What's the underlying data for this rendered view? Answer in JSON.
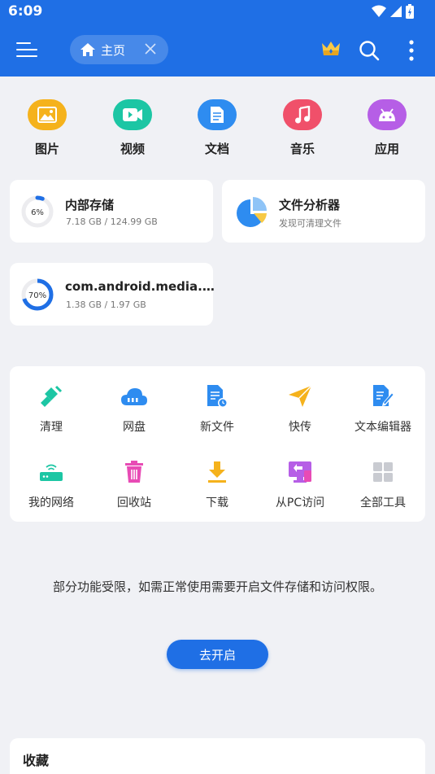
{
  "status_bar": {
    "time": "6:09"
  },
  "app_bar": {
    "tab_label": "主页",
    "icons": [
      "menu-icon",
      "home-icon",
      "close-icon",
      "crown-icon",
      "search-icon",
      "more-vert-icon"
    ]
  },
  "categories": [
    {
      "label": "图片",
      "icon": "image-icon",
      "color": "#f5b21c"
    },
    {
      "label": "视频",
      "icon": "video-icon",
      "color": "#1cc6a4"
    },
    {
      "label": "文档",
      "icon": "document-icon",
      "color": "#2e8cf0"
    },
    {
      "label": "音乐",
      "icon": "music-icon",
      "color": "#f0506a"
    },
    {
      "label": "应用",
      "icon": "android-icon",
      "color": "#b65ee6"
    }
  ],
  "storage": {
    "internal": {
      "title": "内部存储",
      "subtitle": "7.18 GB / 124.99 GB",
      "percent_label": "6%",
      "percent": 0.06
    },
    "analyzer": {
      "title": "文件分析器",
      "subtitle": "发现可清理文件"
    },
    "external": {
      "title": "com.android.media.swc...",
      "subtitle": "1.38 GB / 1.97 GB",
      "percent_label": "70%",
      "percent": 0.7
    }
  },
  "tools": [
    {
      "label": "清理",
      "icon": "broom-icon"
    },
    {
      "label": "网盘",
      "icon": "cloud-icon"
    },
    {
      "label": "新文件",
      "icon": "new-file-icon"
    },
    {
      "label": "快传",
      "icon": "paper-plane-icon"
    },
    {
      "label": "文本编辑器",
      "icon": "text-editor-icon"
    },
    {
      "label": "我的网络",
      "icon": "router-icon"
    },
    {
      "label": "回收站",
      "icon": "trash-icon"
    },
    {
      "label": "下载",
      "icon": "download-icon"
    },
    {
      "label": "从PC访问",
      "icon": "pc-access-icon"
    },
    {
      "label": "全部工具",
      "icon": "grid-icon"
    }
  ],
  "permission": {
    "message": "部分功能受限，如需正常使用需要开启文件存储和访问权限。",
    "button_label": "去开启"
  },
  "favorites": {
    "title": "收藏"
  },
  "colors": {
    "primary": "#1f6fe5",
    "background": "#f0f1f5"
  }
}
